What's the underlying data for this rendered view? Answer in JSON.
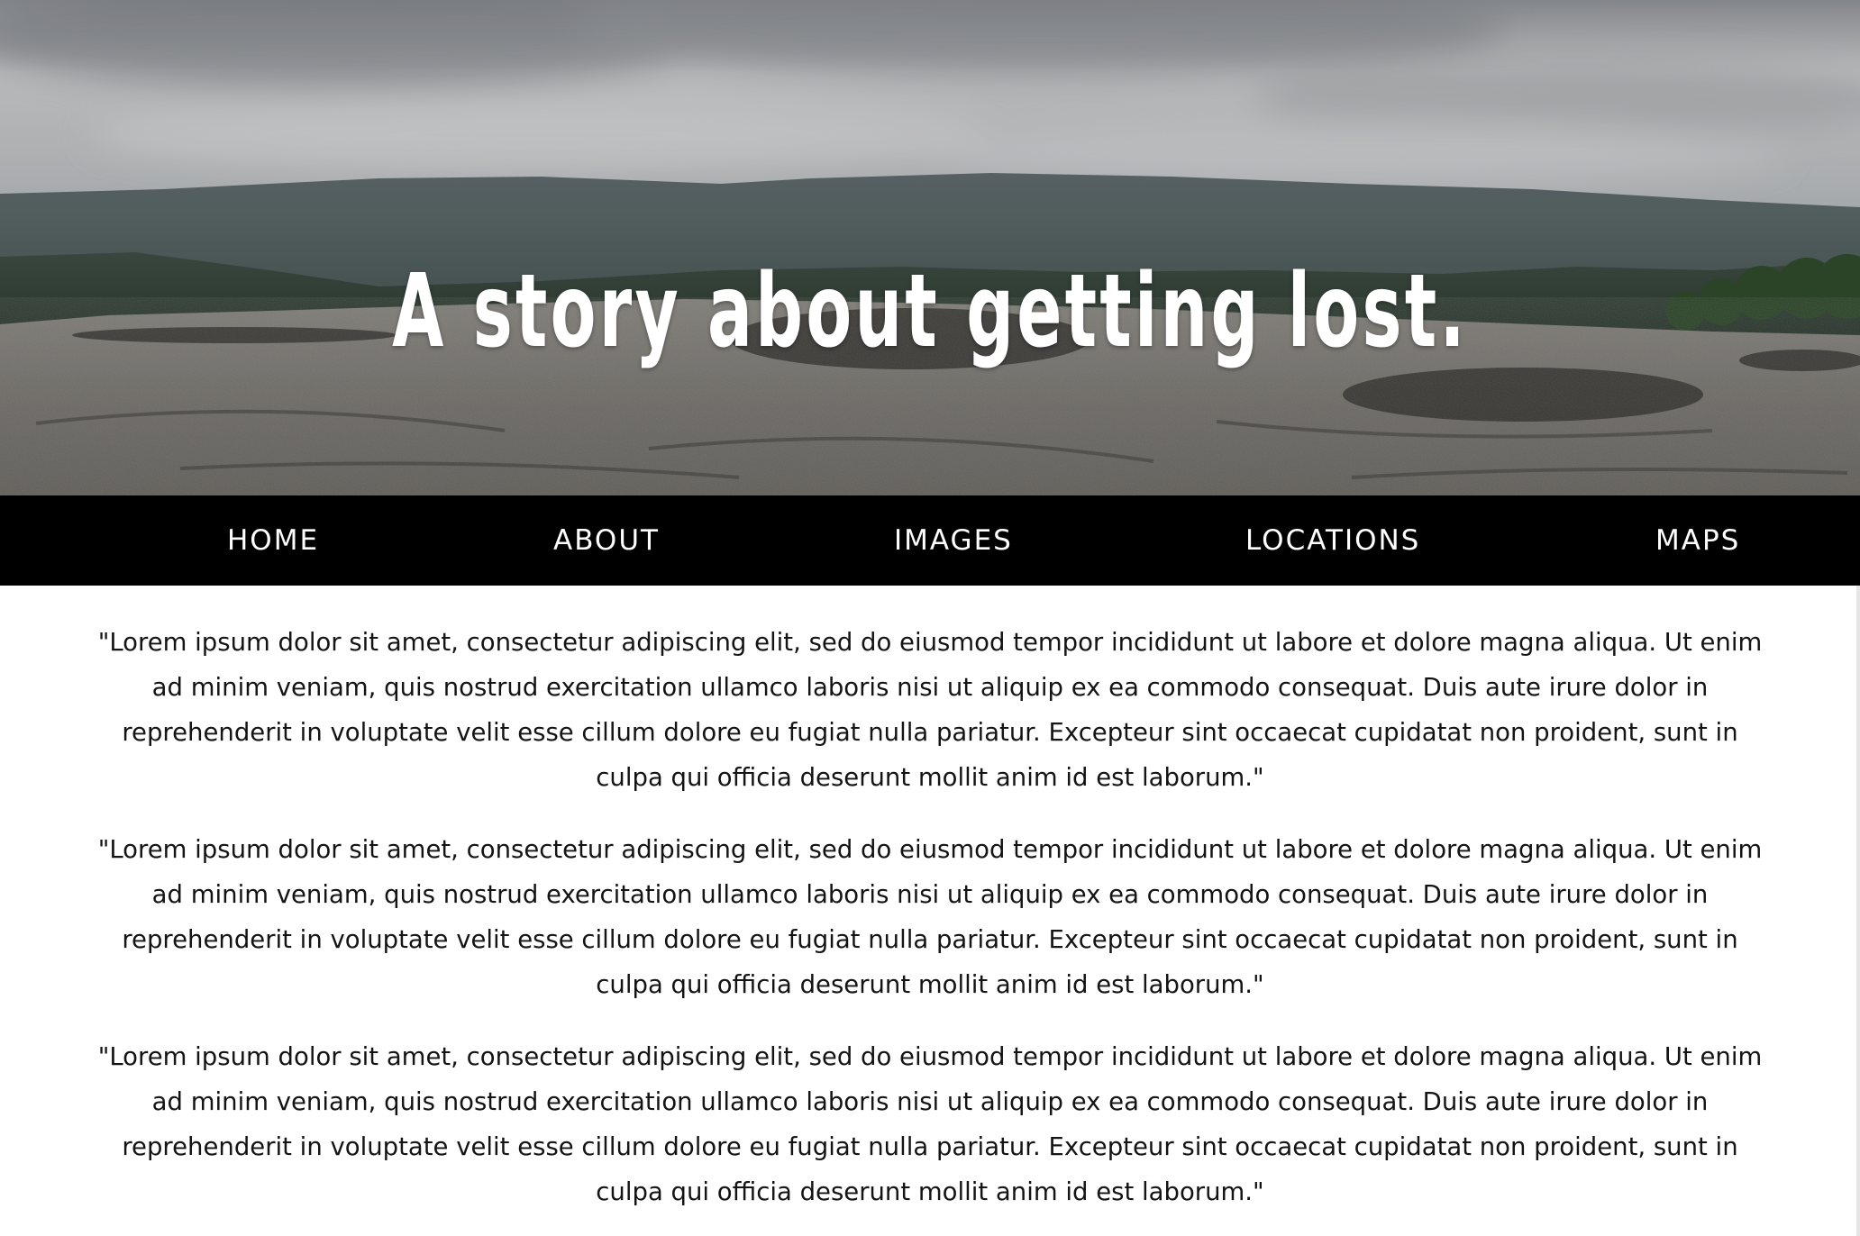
{
  "hero": {
    "title": "A story about getting lost."
  },
  "nav": {
    "items": [
      {
        "label": "HOME"
      },
      {
        "label": "ABOUT"
      },
      {
        "label": "IMAGES"
      },
      {
        "label": "LOCATIONS"
      },
      {
        "label": "MAPS"
      }
    ]
  },
  "main": {
    "paragraphs": [
      "\"Lorem ipsum dolor sit amet, consectetur adipiscing elit, sed do eiusmod tempor incididunt ut labore et dolore magna aliqua. Ut enim ad minim veniam, quis nostrud exercitation ullamco laboris nisi ut aliquip ex ea commodo consequat. Duis aute irure dolor in reprehenderit in voluptate velit esse cillum dolore eu fugiat nulla pariatur. Excepteur sint occaecat cupidatat non proident, sunt in culpa qui officia deserunt mollit anim id est laborum.\"",
      "\"Lorem ipsum dolor sit amet, consectetur adipiscing elit, sed do eiusmod tempor incididunt ut labore et dolore magna aliqua. Ut enim ad minim veniam, quis nostrud exercitation ullamco laboris nisi ut aliquip ex ea commodo consequat. Duis aute irure dolor in reprehenderit in voluptate velit esse cillum dolore eu fugiat nulla pariatur. Excepteur sint occaecat cupidatat non proident, sunt in culpa qui officia deserunt mollit anim id est laborum.\"",
      "\"Lorem ipsum dolor sit amet, consectetur adipiscing elit, sed do eiusmod tempor incididunt ut labore et dolore magna aliqua. Ut enim ad minim veniam, quis nostrud exercitation ullamco laboris nisi ut aliquip ex ea commodo consequat. Duis aute irure dolor in reprehenderit in voluptate velit esse cillum dolore eu fugiat nulla pariatur. Excepteur sint occaecat cupidatat non proident, sunt in culpa qui officia deserunt mollit anim id est laborum.\""
    ]
  },
  "colors": {
    "nav_background": "#000000",
    "nav_text": "#ffffff",
    "body_text": "#141414",
    "hero_title": "#ffffff"
  }
}
